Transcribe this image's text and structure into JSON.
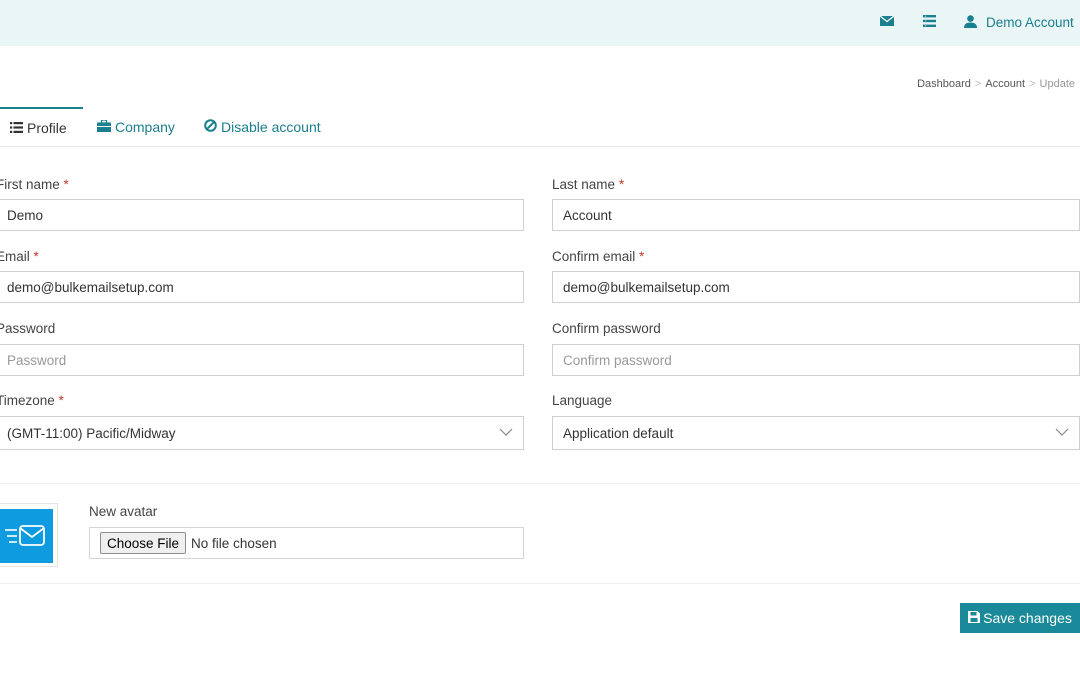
{
  "header": {
    "icons": [
      "envelope-icon",
      "list-icon",
      "user-icon"
    ],
    "user_name": "Demo Account"
  },
  "breadcrumb": {
    "items": [
      "Dashboard",
      "Account",
      "Update"
    ]
  },
  "tabs": [
    {
      "label": "Profile",
      "icon": "list-icon",
      "active": true
    },
    {
      "label": "Company",
      "icon": "briefcase-icon",
      "active": false
    },
    {
      "label": "Disable account",
      "icon": "ban-icon",
      "active": false
    }
  ],
  "form": {
    "first_name": {
      "label": "First name",
      "required": "*",
      "value": "Demo"
    },
    "last_name": {
      "label": "Last name",
      "required": "*",
      "value": "Account"
    },
    "email": {
      "label": "Email",
      "required": "*",
      "value": "demo@bulkemailsetup.com"
    },
    "confirm_email": {
      "label": "Confirm email",
      "required": "*",
      "value": "demo@bulkemailsetup.com"
    },
    "password": {
      "label": "Password",
      "placeholder": "Password",
      "value": ""
    },
    "confirm_password": {
      "label": "Confirm password",
      "placeholder": "Confirm password",
      "value": ""
    },
    "timezone": {
      "label": "Timezone",
      "required": "*",
      "value": "(GMT-11:00) Pacific/Midway"
    },
    "language": {
      "label": "Language",
      "value": "Application default"
    }
  },
  "avatar": {
    "label": "New avatar",
    "choose_button": "Choose File",
    "file_status": "No file chosen"
  },
  "actions": {
    "save_label": "Save changes"
  },
  "colors": {
    "accent": "#1a8a9a",
    "topbar_bg": "#eaf6f6",
    "avatar_bg": "#0f9be0",
    "required": "#c0392b"
  }
}
